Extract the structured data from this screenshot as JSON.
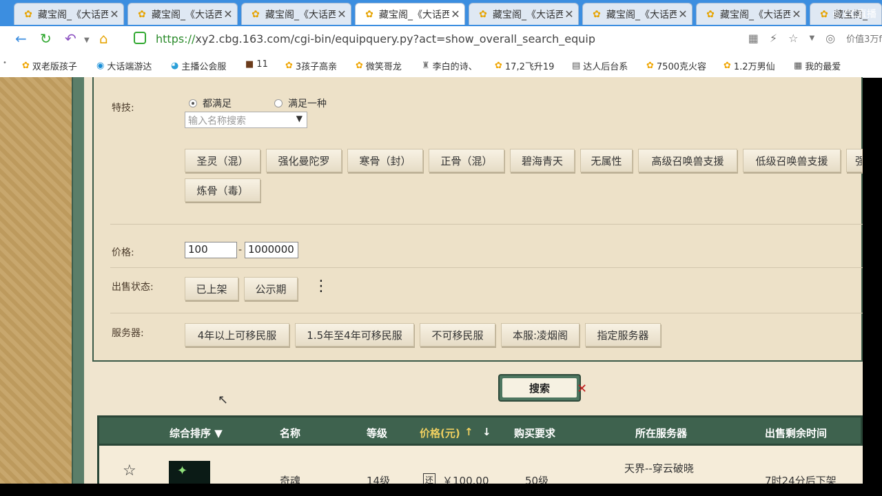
{
  "tabs": [
    {
      "label": "藏宝阁_《大话西",
      "active": false
    },
    {
      "label": "藏宝阁_《大话西",
      "active": false
    },
    {
      "label": "藏宝阁_《大话西",
      "active": false
    },
    {
      "label": "藏宝阁_《大话西",
      "active": true
    },
    {
      "label": "藏宝阁_《大话西",
      "active": false
    },
    {
      "label": "藏宝阁_《大话西",
      "active": false
    },
    {
      "label": "藏宝阁_《大话西",
      "active": false
    },
    {
      "label": "藏宝阁_",
      "active": false
    }
  ],
  "watermark": "CC直播",
  "address": {
    "scheme": "https://",
    "host": "xy2.cbg.163.com",
    "path": "/cgi-bin/equipquery.py?act=show_overall_search_equip",
    "right_text": "价值3万f"
  },
  "bookmarks": [
    "双老版孩子",
    "大话端游达",
    "主播公会服",
    "11",
    "3孩子高亲",
    "微笑哥龙",
    "李白的诗、",
    "17,2飞升19",
    "达人后台系",
    "7500克火容",
    "1.2万男仙",
    "我的最爱"
  ],
  "filters": {
    "skill_label": "特技:",
    "opt_all": "都满足",
    "opt_one": "满足一种",
    "skill_search_placeholder": "输入名称搜索",
    "skills": [
      "圣灵（混）",
      "强化曼陀罗",
      "寒骨（封）",
      "正骨（混）",
      "碧海青天",
      "无属性",
      "高级召唤兽支援",
      "低级召唤兽支援",
      "强",
      "炼骨（毒）"
    ],
    "price_label": "价格:",
    "price_min": "100",
    "price_sep": "-",
    "price_max": "1000000",
    "status_label": "出售状态:",
    "status_options": [
      "已上架",
      "公示期"
    ],
    "server_label": "服务器:",
    "server_options": [
      "4年以上可移民服",
      "1.5年至4年可移民服",
      "不可移民服",
      "本服:凌烟阁",
      "指定服务器"
    ]
  },
  "search_button": "搜索",
  "table": {
    "headers": [
      "综合排序 ▼",
      "名称",
      "等级",
      "价格(元)",
      "购买要求",
      "所在服务器",
      "出售剩余时间"
    ],
    "row": {
      "name": "奇魂",
      "level": "14级",
      "price": "￥100.00",
      "req": "50级",
      "server": "天界--穿云破晓",
      "time": "7时24分后下架"
    }
  },
  "colors": {
    "accent": "#3e624e",
    "page_bg": "#efe4cd",
    "tab_bar": "#3c8ee0"
  }
}
